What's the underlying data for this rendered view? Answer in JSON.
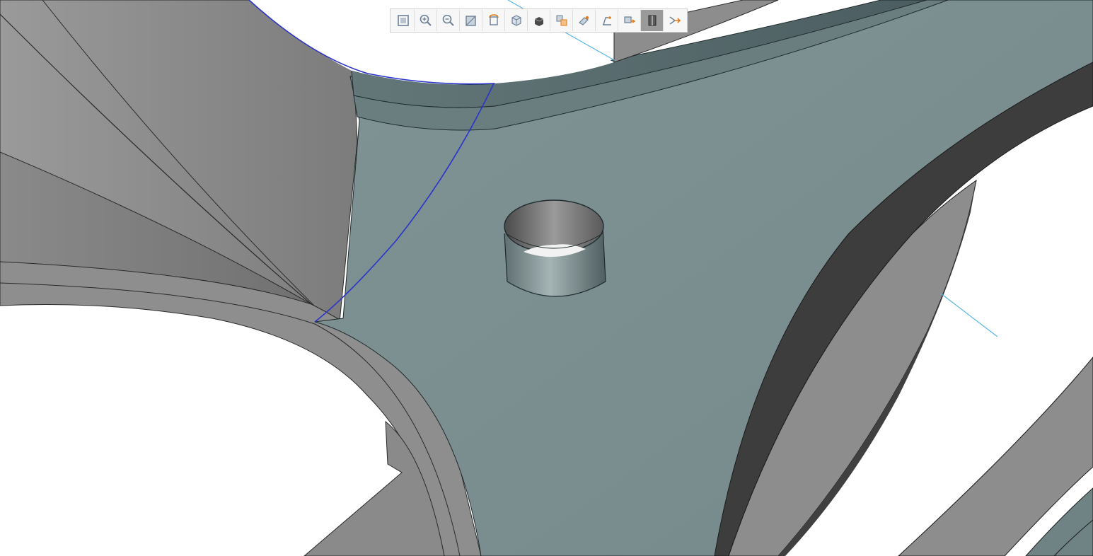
{
  "colors": {
    "background": "#ffffff",
    "part_face": "#7a8c8e",
    "part_face_dark": "#5e7174",
    "part_edge": "#1e2a2c",
    "hidden_surface": "#8d8d8d",
    "hidden_surface_dark": "#6f6f6f",
    "side_wall": "#3d3d3d",
    "selection_curve": "#2a33cc",
    "axis_line": "#55b6e0",
    "toolbar_icon": "#6b7f96",
    "toolbar_accent": "#e07a1a"
  },
  "toolbar": {
    "buttons": [
      {
        "icon": "zoom-fit-icon",
        "active": false
      },
      {
        "icon": "zoom-in-icon",
        "active": false
      },
      {
        "icon": "zoom-out-icon",
        "active": false
      },
      {
        "icon": "view-front-icon",
        "active": false
      },
      {
        "icon": "rotate-view-icon",
        "active": false
      },
      {
        "icon": "view-iso-icon",
        "active": false
      },
      {
        "icon": "display-style-icon",
        "active": false
      },
      {
        "icon": "hide-show-icon",
        "active": false
      },
      {
        "icon": "edit-appearance-icon",
        "active": false
      },
      {
        "icon": "apply-scene-icon",
        "active": false
      },
      {
        "icon": "view-settings-icon",
        "active": false
      },
      {
        "icon": "section-view-icon",
        "active": true
      },
      {
        "icon": "dimension-arrow-icon",
        "active": false
      }
    ]
  },
  "scene": {
    "part": "3d-flange-bracket",
    "features": [
      "boss-hole",
      "rim-flange",
      "selected-edge-curve",
      "axis-line"
    ]
  }
}
